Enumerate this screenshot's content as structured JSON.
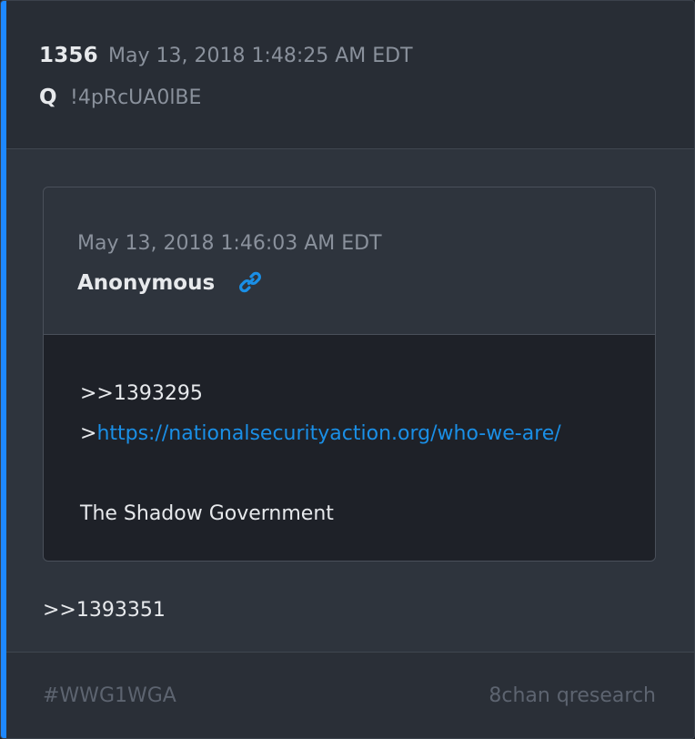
{
  "post": {
    "number": "1356",
    "timestamp": "May 13, 2018 1:48:25 AM EDT",
    "author": "Q",
    "tripcode": "!4pRcUA0lBE",
    "accent_color": "#1e88ff"
  },
  "quoted": {
    "timestamp": "May 13, 2018 1:46:03 AM EDT",
    "author": "Anonymous",
    "link_icon": "link-icon",
    "lines": {
      "ref": ">>1393295",
      "url_prefix": ">",
      "url": "https://nationalsecurityaction.org/who-we-are/",
      "text": "The Shadow Government"
    }
  },
  "reply": {
    "ref": ">>1393351"
  },
  "footer": {
    "hashtag": "#WWG1WGA",
    "source": "8chan qresearch"
  }
}
